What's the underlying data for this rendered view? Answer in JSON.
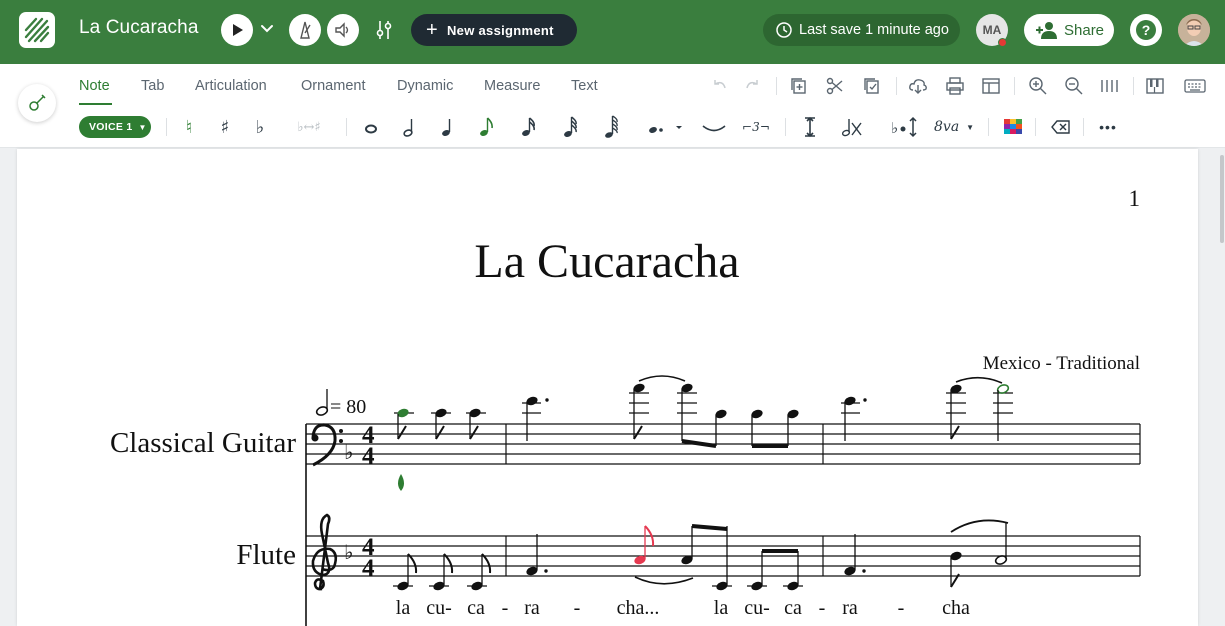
{
  "app": {
    "document_title": "La Cucaracha",
    "new_assignment_label": "New assignment",
    "last_save": "Last save 1 minute ago",
    "user_initials": "MA",
    "share_label": "Share",
    "help_label": "?",
    "brand_color": "#3a7e3e"
  },
  "toolbar": {
    "tabs": [
      {
        "label": "Note",
        "active": true
      },
      {
        "label": "Tab"
      },
      {
        "label": "Articulation"
      },
      {
        "label": "Ornament"
      },
      {
        "label": "Dynamic"
      },
      {
        "label": "Measure"
      },
      {
        "label": "Text"
      }
    ],
    "voice_label": "VOICE 1",
    "right_icons": [
      "undo-icon",
      "redo-icon",
      "copy-icon",
      "cut-icon",
      "paste-icon",
      "cloud-download-icon",
      "print-icon",
      "layout-icon",
      "zoom-in-icon",
      "zoom-out-icon",
      "bar-view-icon",
      "piano-icon",
      "keyboard-icon"
    ],
    "note_icons": [
      "natural-icon",
      "sharp-icon",
      "flat-icon",
      "enharmonic-icon",
      "whole-note-icon",
      "half-note-icon",
      "quarter-note-icon",
      "eighth-note-icon",
      "sixteenth-note-icon",
      "thirty-second-note-icon",
      "sixty-fourth-note-icon",
      "dot-icon",
      "tie-icon",
      "tuplet-icon",
      "stem-icon",
      "cross-note-icon",
      "transpose-icon",
      "octave-icon",
      "color-icon",
      "delete-icon",
      "more-icon"
    ],
    "tuplet_label": "3",
    "octave_label": "8va"
  },
  "score": {
    "page_number": "1",
    "title": "La Cucaracha",
    "composer": "Mexico - Traditional",
    "tempo_value": "= 80",
    "time_signature": "4/4",
    "key_signature": "F major (1 flat)",
    "instruments": [
      {
        "name": "Classical Guitar",
        "clef": "bass"
      },
      {
        "name": "Flute",
        "clef": "treble"
      }
    ],
    "lyrics": [
      "la",
      "cu-",
      "ca",
      "-",
      "ra",
      "-",
      "cha...",
      "la",
      "cu-",
      "ca",
      "-",
      "ra",
      "-",
      "cha"
    ],
    "highlight_color": "#e53950",
    "cursor_color": "#2e7d32"
  }
}
